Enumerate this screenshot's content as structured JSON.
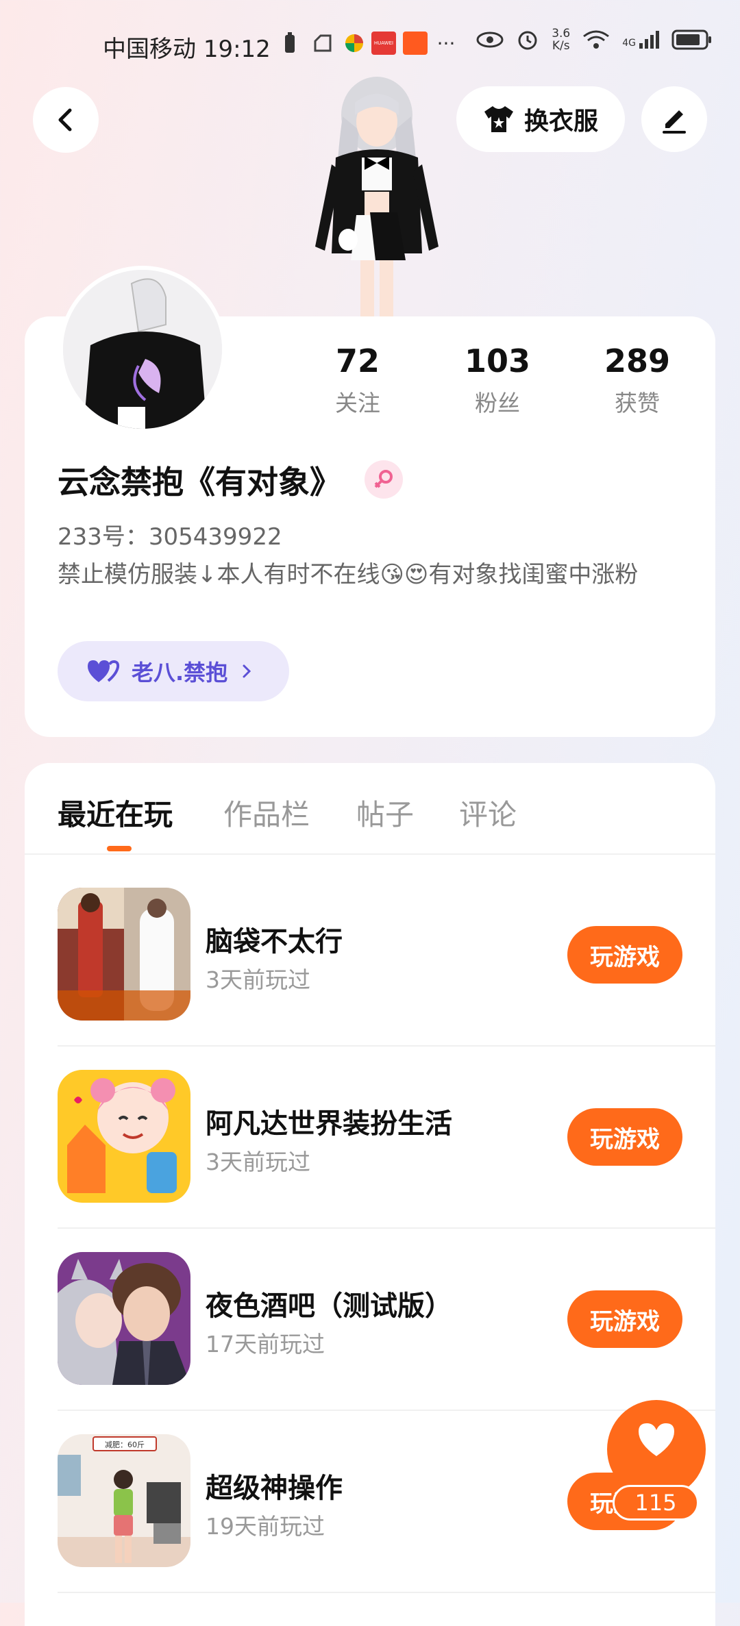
{
  "status_bar": {
    "carrier": "中国移动",
    "time": "19:12",
    "net_speed_value": "3.6",
    "net_speed_unit": "K/s",
    "network": "4G",
    "more": "···",
    "app_icon_label": "HUAWEI"
  },
  "header": {
    "outfit_label": "换衣服"
  },
  "profile": {
    "nickname": "云念禁抱《有对象》",
    "uid": "233号：305439922",
    "bio": "禁止模仿服装↓本人有时不在线😘😍有对象找闺蜜中涨粉",
    "partner_label": "老八.禁抱",
    "stats": [
      {
        "value": "72",
        "label": "关注"
      },
      {
        "value": "103",
        "label": "粉丝"
      },
      {
        "value": "289",
        "label": "获赞"
      }
    ]
  },
  "tabs": [
    "最近在玩",
    "作品栏",
    "帖子",
    "评论"
  ],
  "games": [
    {
      "title": "脑袋不太行",
      "played": "3天前玩过",
      "action": "玩游戏"
    },
    {
      "title": "阿凡达世界装扮生活",
      "played": "3天前玩过",
      "action": "玩游戏"
    },
    {
      "title": "夜色酒吧（测试版）",
      "played": "17天前玩过",
      "action": "玩游戏"
    },
    {
      "title": "超级神操作",
      "played": "19天前玩过",
      "action": "玩游戏"
    }
  ],
  "game4_banner": "减肥：60斤",
  "like": {
    "count": "115"
  },
  "colors": {
    "accent": "#ff6a1a",
    "partner": "#5b4fd6",
    "female": "#f06292"
  }
}
